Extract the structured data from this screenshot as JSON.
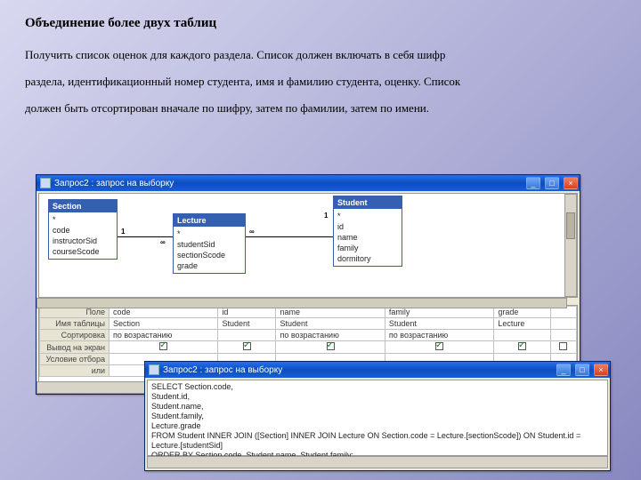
{
  "title": "Объединение более двух таблиц",
  "para1": "Получить список оценок для каждого раздела. Список должен включать в себя шифр",
  "para2": "раздела, идентификационный номер студента, имя и фамилию студента, оценку. Список",
  "para3": "должен быть отсортирован вначале по шифру, затем по фамилии, затем по имени.",
  "win1": {
    "title": "Запрос2 : запрос на выборку",
    "tables": {
      "section": {
        "name": "Section",
        "fields": [
          "*",
          "code",
          "instructorSid",
          "courseScode"
        ]
      },
      "lecture": {
        "name": "Lecture",
        "fields": [
          "*",
          "studentSid",
          "sectionScode",
          "grade"
        ]
      },
      "student": {
        "name": "Student",
        "fields": [
          "*",
          "id",
          "name",
          "family",
          "dormitory"
        ]
      }
    },
    "rel": {
      "one": "1",
      "many": "∞"
    },
    "grid": {
      "rows": [
        "Поле",
        "Имя таблицы",
        "Сортировка",
        "Вывод на экран",
        "Условие отбора",
        "или"
      ],
      "cols": [
        {
          "field": "code",
          "table": "Section",
          "sort": "по возрастанию",
          "show": true
        },
        {
          "field": "id",
          "table": "Student",
          "sort": "",
          "show": true
        },
        {
          "field": "name",
          "table": "Student",
          "sort": "по возрастанию",
          "show": true
        },
        {
          "field": "family",
          "table": "Student",
          "sort": "по возрастанию",
          "show": true
        },
        {
          "field": "grade",
          "table": "Lecture",
          "sort": "",
          "show": true
        }
      ]
    }
  },
  "win2": {
    "title": "Запрос2 : запрос на выборку",
    "sql": [
      "SELECT Section.code,",
      "Student.id,",
      "Student.name,",
      "Student.family,",
      "Lecture.grade",
      "FROM Student INNER JOIN ([Section] INNER JOIN Lecture ON Section.code = Lecture.[sectionScode]) ON Student.id = Lecture.[studentSid]",
      "ORDER BY Section.code, Student.name, Student.family;"
    ]
  },
  "btn": {
    "min": "_",
    "max": "□",
    "close": "×"
  }
}
